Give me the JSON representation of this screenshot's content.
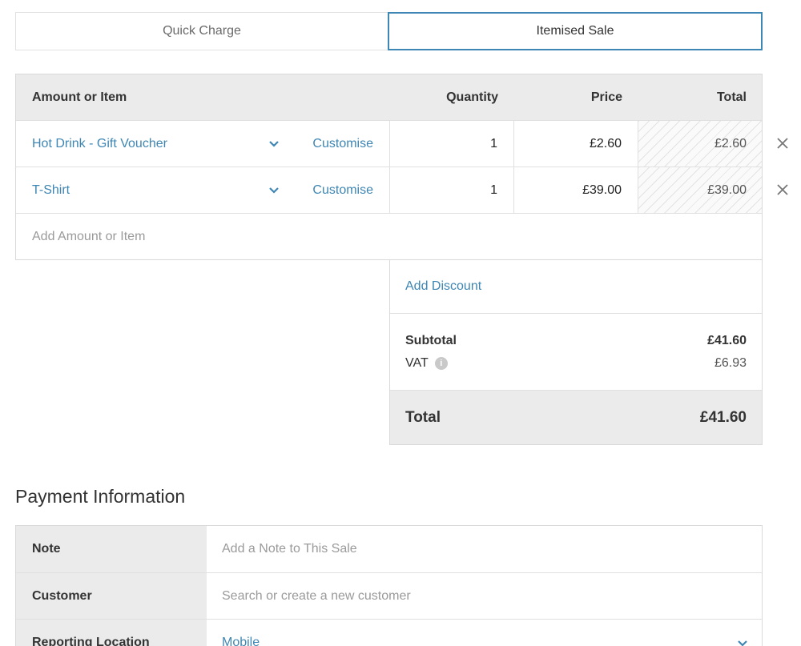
{
  "tabs": [
    {
      "label": "Quick Charge"
    },
    {
      "label": "Itemised Sale"
    }
  ],
  "table": {
    "headers": {
      "item": "Amount or Item",
      "quantity": "Quantity",
      "price": "Price",
      "total": "Total"
    },
    "rows": [
      {
        "name": "Hot Drink - Gift Voucher",
        "customise": "Customise",
        "quantity": "1",
        "price": "£2.60",
        "total": "£2.60"
      },
      {
        "name": "T-Shirt",
        "customise": "Customise",
        "quantity": "1",
        "price": "£39.00",
        "total": "£39.00"
      }
    ],
    "add_placeholder": "Add Amount or Item"
  },
  "summary": {
    "add_discount": "Add Discount",
    "subtotal_label": "Subtotal",
    "subtotal_value": "£41.60",
    "vat_label": "VAT",
    "vat_info": "i",
    "vat_value": "£6.93",
    "total_label": "Total",
    "total_value": "£41.60"
  },
  "payment": {
    "title": "Payment Information",
    "note_label": "Note",
    "note_placeholder": "Add a Note to This Sale",
    "customer_label": "Customer",
    "customer_placeholder": "Search or create a new customer",
    "location_label": "Reporting Location",
    "location_value": "Mobile"
  },
  "colors": {
    "accent": "#3e86b3",
    "header_bg": "#ebebeb"
  }
}
